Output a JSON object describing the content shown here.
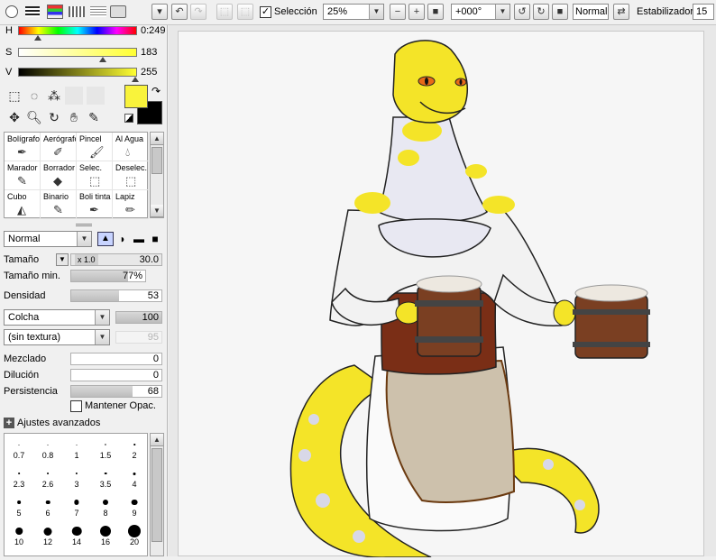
{
  "toolbar": {
    "selection_label": "Selección",
    "selection_checked": true,
    "zoom_value": "25%",
    "rotation_value": "+000°",
    "blend_mode": "Normal",
    "stabilizer_label": "Estabilizador",
    "stabilizer_value": "15"
  },
  "color": {
    "h_label": "H",
    "h_value": "0:249",
    "s_label": "S",
    "s_value": "183",
    "v_label": "V",
    "v_value": "255",
    "primary": "#f9f33b",
    "secondary": "#000000"
  },
  "brushes": [
    {
      "label": "Bolígrafo",
      "icon": "pen-icon"
    },
    {
      "label": "Aerógrafo",
      "icon": "airbrush-icon"
    },
    {
      "label": "Pincel",
      "icon": "brush-icon"
    },
    {
      "label": "Al Agua",
      "icon": "watercolor-icon"
    },
    {
      "label": "Marador",
      "icon": "marker-icon"
    },
    {
      "label": "Borrador",
      "icon": "eraser-icon"
    },
    {
      "label": "Selec.",
      "icon": "select-pen-icon"
    },
    {
      "label": "Deselec.",
      "icon": "deselect-icon"
    },
    {
      "label": "Cubo",
      "icon": "bucket-icon"
    },
    {
      "label": "Binario",
      "icon": "binary-pen-icon"
    },
    {
      "label": "Boli tinta",
      "icon": "ink-pen-icon"
    },
    {
      "label": "Lapiz",
      "icon": "pencil-icon"
    }
  ],
  "brush_settings": {
    "mode": "Normal",
    "size_label": "Tamaño",
    "size_mult": "x 1.0",
    "size_value": "30.0",
    "min_size_label": "Tamaño min.",
    "min_size_value": "77%",
    "min_size_fraction": 0.77,
    "density_label": "Densidad",
    "density_value": "53",
    "density_fraction": 0.53,
    "shape": "Colcha",
    "shape_value": "100",
    "texture": "(sin textura)",
    "texture_value": "95",
    "blend_label": "Mezclado",
    "blend_value": "0",
    "dilution_label": "Dilución",
    "dilution_value": "0",
    "persistence_label": "Persistencia",
    "persistence_value": "68",
    "persistence_fraction": 0.68,
    "keep_opacity_label": "Mantener Opac.",
    "advanced_label": "Ajustes avanzados"
  },
  "brush_sizes": [
    "0.7",
    "0.8",
    "1",
    "1.5",
    "2",
    "2.3",
    "2.6",
    "3",
    "3.5",
    "4",
    "5",
    "6",
    "7",
    "8",
    "9",
    "10",
    "12",
    "14",
    "16",
    "20"
  ]
}
